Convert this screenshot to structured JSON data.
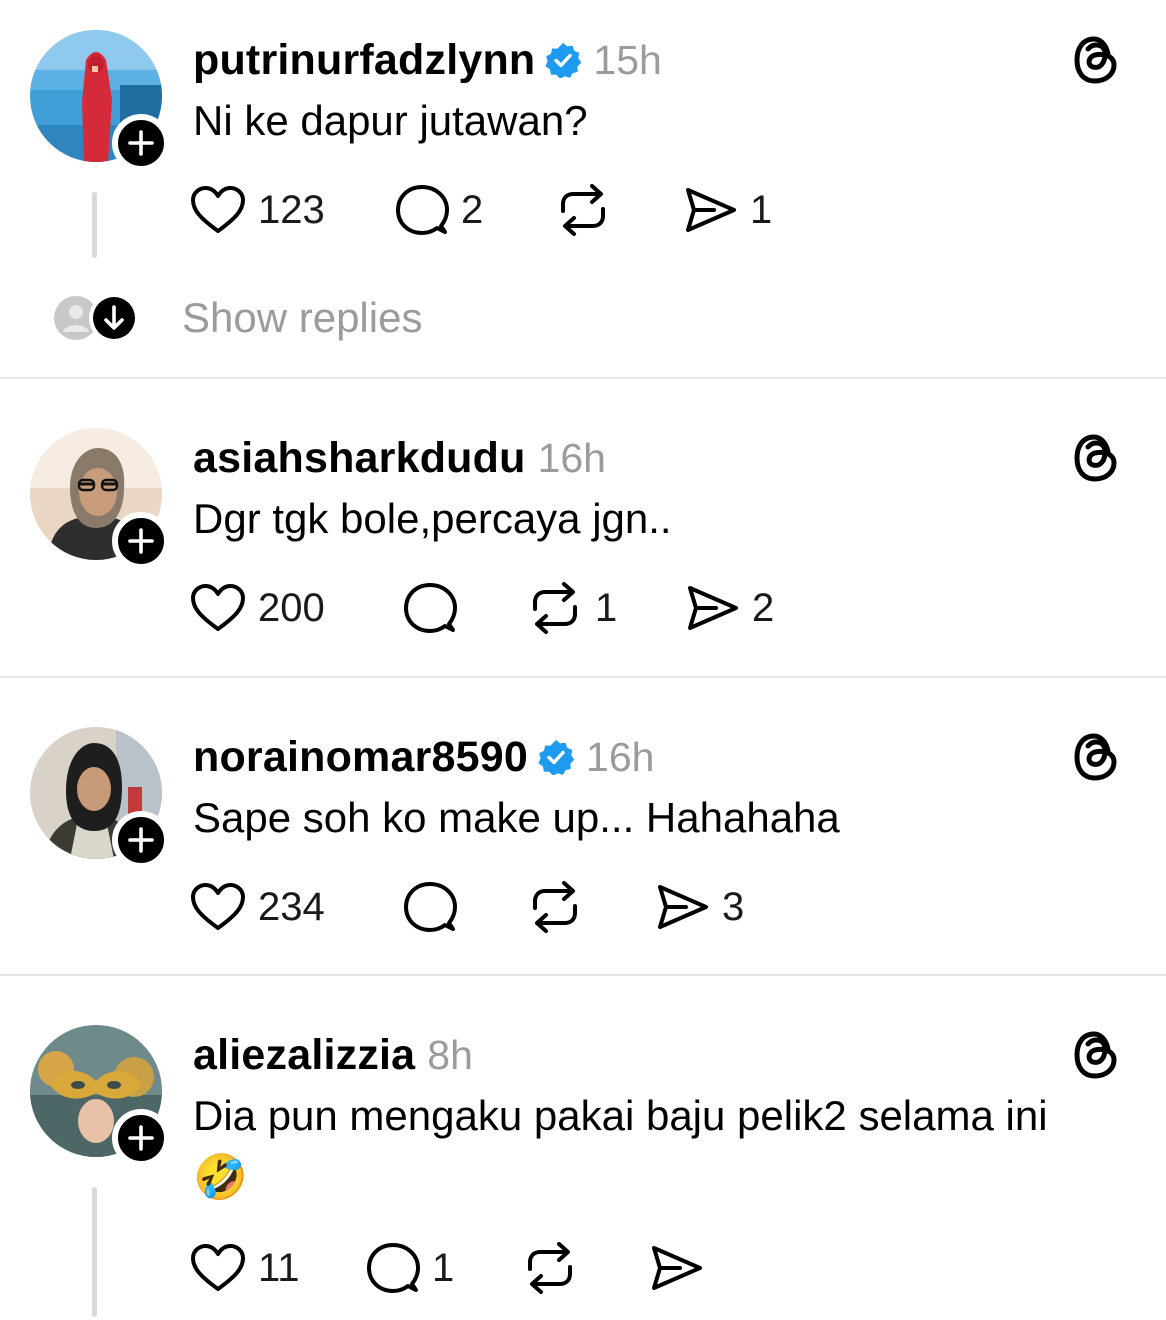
{
  "posts": [
    {
      "username": "putrinurfadzlynn",
      "verified": true,
      "time": "15h",
      "text": "Ni ke dapur jutawan?",
      "likes": "123",
      "replies": "2",
      "reposts": "",
      "shares": "1",
      "show_replies": "Show replies"
    },
    {
      "username": "asiahsharkdudu",
      "verified": false,
      "time": "16h",
      "text": "Dgr tgk bole,percaya jgn..",
      "likes": "200",
      "replies": "",
      "reposts": "1",
      "shares": "2"
    },
    {
      "username": "norainomar8590",
      "verified": true,
      "time": "16h",
      "text": "Sape soh ko make up... Hahahaha",
      "likes": "234",
      "replies": "",
      "reposts": "",
      "shares": "3"
    },
    {
      "username": "aliezalizzia",
      "verified": false,
      "time": "8h",
      "text": "Dia pun mengaku pakai baju pelik2 selama ini",
      "emoji": "🤣",
      "likes": "11",
      "replies": "1",
      "reposts": "",
      "shares": ""
    }
  ],
  "colors": {
    "verified": "#1d9bf0",
    "muted": "#9b9b9b",
    "divider": "#e6e6e6"
  },
  "icons": [
    "plus-icon",
    "verified-badge-icon",
    "threads-logo-icon",
    "heart-icon",
    "comment-icon",
    "repost-icon",
    "share-icon",
    "arrow-down-icon"
  ]
}
